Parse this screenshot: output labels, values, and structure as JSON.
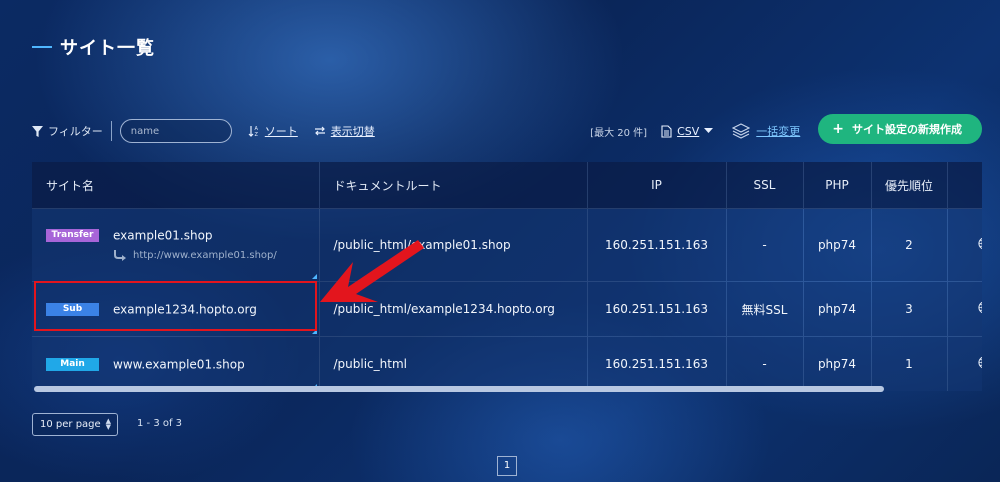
{
  "page": {
    "title": "サイト一覧"
  },
  "toolbar": {
    "filter_label": "フィルター",
    "search_placeholder": "name",
    "sort_label": "ソート",
    "toggle_label": "表示切替",
    "max_note": "[最大 20 件]",
    "csv_label": "CSV",
    "bulk_label": "一括変更",
    "create_label": "サイト設定の新規作成"
  },
  "table": {
    "headers": [
      "サイト名",
      "ドキュメントルート",
      "IP",
      "SSL",
      "PHP",
      "優先順位"
    ],
    "rows": [
      {
        "badge": "Transfer",
        "domain": "example01.shop",
        "redirect": "http://www.example01.shop/",
        "docroot": "/public_html/example01.shop",
        "ip": "160.251.151.163",
        "ssl": "-",
        "php": "php74",
        "priority": "2"
      },
      {
        "badge": "Sub",
        "domain": "example1234.hopto.org",
        "docroot": "/public_html/example1234.hopto.org",
        "ip": "160.251.151.163",
        "ssl": "無料SSL",
        "php": "php74",
        "priority": "3"
      },
      {
        "badge": "Main",
        "domain": "www.example01.shop",
        "docroot": "/public_html",
        "ip": "160.251.151.163",
        "ssl": "-",
        "php": "php74",
        "priority": "1"
      }
    ]
  },
  "pagination": {
    "per_page": "10 per page",
    "range": "1 - 3 of 3",
    "current_page": "1"
  },
  "colors": {
    "accent": "#4fb6ff",
    "create_button": "#1fb57f",
    "badge_transfer": "#a765d8",
    "badge_sub": "#3b82e6",
    "badge_main": "#20a8e8",
    "highlight": "#e3151d"
  },
  "icons": [
    "filter-icon",
    "sort-icon",
    "toggle-icon",
    "document-icon",
    "caret-down-icon",
    "layers-icon",
    "plus-icon",
    "redirect-arrow-icon",
    "globe-icon"
  ]
}
